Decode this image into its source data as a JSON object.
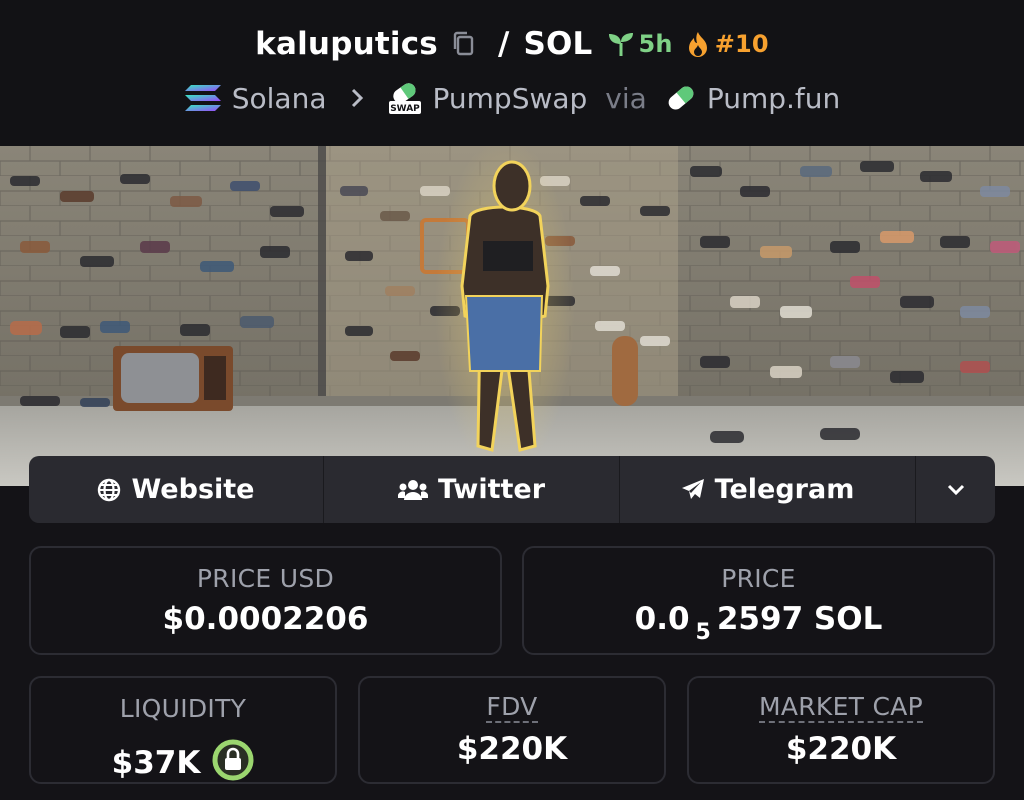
{
  "header": {
    "token_name": "kaluputics",
    "separator": "/",
    "quote": "SOL",
    "age": "5h",
    "rank": "#10"
  },
  "chain": {
    "network": "Solana",
    "dex": "PumpSwap",
    "via_label": "via",
    "launchpad": "Pump.fun",
    "swap_logo_text": "SWAP"
  },
  "links": {
    "website": "Website",
    "twitter": "Twitter",
    "telegram": "Telegram"
  },
  "stats": {
    "price_usd_label": "PRICE USD",
    "price_usd_value": "$0.0002206",
    "price_label": "PRICE",
    "price_value_prefix": "0.0",
    "price_value_zeros": "5",
    "price_value_suffix": "2597 SOL",
    "liquidity_label": "LIQUIDITY",
    "liquidity_value": "$37K",
    "fdv_label": "FDV",
    "fdv_value": "$220K",
    "market_cap_label": "MARKET CAP",
    "market_cap_value": "$220K"
  },
  "colors": {
    "age_green": "#7fd186",
    "rank_orange": "#f7a12f",
    "lock_green": "#9bd66f"
  },
  "icons": [
    "copy-icon",
    "seedling-icon",
    "flame-icon",
    "solana-logo",
    "chevron-right-icon",
    "pumpswap-logo",
    "pill-icon",
    "globe-icon",
    "users-icon",
    "paper-plane-icon",
    "chevron-down-icon",
    "lock-icon"
  ]
}
